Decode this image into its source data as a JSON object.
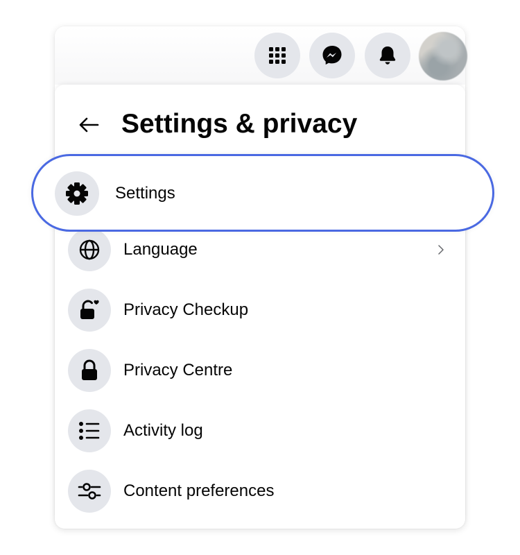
{
  "top_bar": {
    "icons": [
      {
        "name": "menu-grid-icon"
      },
      {
        "name": "messenger-icon"
      },
      {
        "name": "notifications-bell-icon"
      }
    ],
    "avatar": {
      "name": "profile-avatar"
    }
  },
  "panel": {
    "title": "Settings & privacy",
    "back_icon": "back-arrow-icon",
    "highlight_color": "#4a69e2",
    "items": [
      {
        "label": "Settings",
        "icon": "gear-icon",
        "highlighted": true
      },
      {
        "label": "Language",
        "icon": "globe-icon",
        "chevron": true
      },
      {
        "label": "Privacy Checkup",
        "icon": "lock-heart-icon"
      },
      {
        "label": "Privacy Centre",
        "icon": "lock-icon"
      },
      {
        "label": "Activity log",
        "icon": "list-icon"
      },
      {
        "label": "Content preferences",
        "icon": "sliders-icon"
      }
    ]
  }
}
